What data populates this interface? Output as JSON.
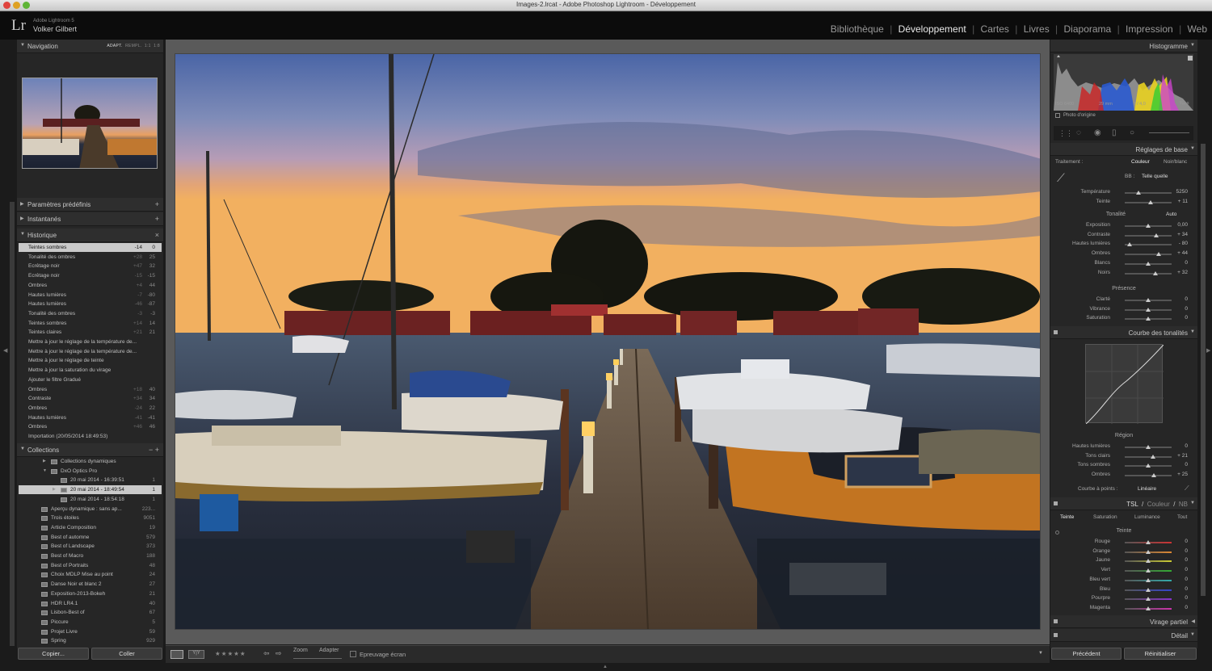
{
  "window": {
    "title": "Images-2.lrcat - Adobe Photoshop Lightroom - Développement"
  },
  "identity": {
    "logo": "Lr",
    "app": "Adobe Lightroom 5",
    "user": "Volker Gilbert"
  },
  "modules": [
    "Bibliothèque",
    "Développement",
    "Cartes",
    "Livres",
    "Diaporama",
    "Impression",
    "Web"
  ],
  "navigator": {
    "title": "Navigation",
    "options": [
      "ADAPT.",
      "REMPL.",
      "1:1",
      "1:8"
    ]
  },
  "presets": {
    "title": "Paramètres prédéfinis"
  },
  "snapshots": {
    "title": "Instantanés"
  },
  "history": {
    "title": "Historique",
    "items": [
      {
        "label": "Teintes sombres",
        "a": "-14",
        "b": "0"
      },
      {
        "label": "Tonalité des ombres",
        "a": "+28",
        "b": "25"
      },
      {
        "label": "Ecrêtage noir",
        "a": "+47",
        "b": "32"
      },
      {
        "label": "Ecrêtage noir",
        "a": "-15",
        "b": "-15"
      },
      {
        "label": "Ombres",
        "a": "+4",
        "b": "44"
      },
      {
        "label": "Hautes lumières",
        "a": "-7",
        "b": "-80"
      },
      {
        "label": "Hautes lumières",
        "a": "-46",
        "b": "-87"
      },
      {
        "label": "Tonalité des ombres",
        "a": "-3",
        "b": "-3"
      },
      {
        "label": "Teintes sombres",
        "a": "+14",
        "b": "14"
      },
      {
        "label": "Teintes claires",
        "a": "+21",
        "b": "21"
      },
      {
        "label": "Mettre à jour le réglage de la température de...",
        "a": "",
        "b": ""
      },
      {
        "label": "Mettre à jour le réglage de la température de...",
        "a": "",
        "b": ""
      },
      {
        "label": "Mettre à jour le réglage de teinte",
        "a": "",
        "b": ""
      },
      {
        "label": "Mettre à jour la saturation du virage",
        "a": "",
        "b": ""
      },
      {
        "label": "Ajouter le filtre Gradué",
        "a": "",
        "b": ""
      },
      {
        "label": "Ombres",
        "a": "+18",
        "b": "40"
      },
      {
        "label": "Contraste",
        "a": "+34",
        "b": "34"
      },
      {
        "label": "Ombres",
        "a": "-24",
        "b": "22"
      },
      {
        "label": "Hautes lumières",
        "a": "-41",
        "b": "-41"
      },
      {
        "label": "Ombres",
        "a": "+46",
        "b": "46"
      },
      {
        "label": "Importation (20/05/2014 18:49:53)",
        "a": "",
        "b": ""
      }
    ]
  },
  "collections": {
    "title": "Collections",
    "items": [
      {
        "label": "Collections dynamiques",
        "count": "",
        "lvl": 1,
        "tri": "▶"
      },
      {
        "label": "DxO Optics Pro",
        "count": "",
        "lvl": 1,
        "tri": "▼"
      },
      {
        "label": "20 mai 2014 - 16:39:51",
        "count": "1",
        "lvl": 2,
        "tri": ""
      },
      {
        "label": "20 mai 2014 - 18:49:54",
        "count": "1",
        "lvl": 2,
        "tri": "▶"
      },
      {
        "label": "20 mai 2014 - 18:54:18",
        "count": "1",
        "lvl": 2,
        "tri": ""
      },
      {
        "label": "Aperçu dynamique : sans ap...",
        "count": "223...",
        "lvl": 0,
        "tri": ""
      },
      {
        "label": "Trois étoiles",
        "count": "9051",
        "lvl": 0,
        "tri": ""
      },
      {
        "label": "Article Composition",
        "count": "19",
        "lvl": 0,
        "tri": ""
      },
      {
        "label": "Best of automne",
        "count": "579",
        "lvl": 0,
        "tri": ""
      },
      {
        "label": "Best of Landscape",
        "count": "373",
        "lvl": 0,
        "tri": ""
      },
      {
        "label": "Best of Macro",
        "count": "188",
        "lvl": 0,
        "tri": ""
      },
      {
        "label": "Best of Portraits",
        "count": "48",
        "lvl": 0,
        "tri": ""
      },
      {
        "label": "Choix MDLP Mise au point",
        "count": "24",
        "lvl": 0,
        "tri": ""
      },
      {
        "label": "Danse Noir et blanc 2",
        "count": "27",
        "lvl": 0,
        "tri": ""
      },
      {
        "label": "Exposition-2013-Bokeh",
        "count": "21",
        "lvl": 0,
        "tri": ""
      },
      {
        "label": "HDR LR4.1",
        "count": "40",
        "lvl": 0,
        "tri": ""
      },
      {
        "label": "Lisbon-Best of",
        "count": "67",
        "lvl": 0,
        "tri": ""
      },
      {
        "label": "Piccure",
        "count": "5",
        "lvl": 0,
        "tri": ""
      },
      {
        "label": "Projet Livre",
        "count": "59",
        "lvl": 0,
        "tri": ""
      },
      {
        "label": "Spring",
        "count": "929",
        "lvl": 0,
        "tri": ""
      }
    ]
  },
  "left_buttons": {
    "copy": "Copier...",
    "paste": "Coller"
  },
  "toolbar": {
    "zoom": "Zoom",
    "fit": "Adapter",
    "softproof": "Epreuvage écran",
    "stars": "★★★★★"
  },
  "histogram": {
    "title": "Histogramme",
    "iso": "ISO 6400",
    "focal": "29 mm",
    "aperture": "f / 4,0",
    "shutter": "¹⁄₆₄ s",
    "original": "Photo d'origine"
  },
  "basic": {
    "title": "Réglages de base",
    "treatment": "Traitement :",
    "color": "Couleur",
    "bw": "Noir/blanc",
    "wb_label": "BB :",
    "wb_value": "Telle quelle",
    "tone": "Tonalité",
    "auto": "Auto",
    "presence": "Présence",
    "sliders_wb": [
      {
        "label": "Température",
        "value": "5250",
        "pos": 0.3
      },
      {
        "label": "Teinte",
        "value": "+ 11",
        "pos": 0.55
      }
    ],
    "sliders_tone": [
      {
        "label": "Exposition",
        "value": "0,00",
        "pos": 0.5
      },
      {
        "label": "Contraste",
        "value": "+ 34",
        "pos": 0.67
      },
      {
        "label": "Hautes lumières",
        "value": "- 80",
        "pos": 0.1
      },
      {
        "label": "Ombres",
        "value": "+ 44",
        "pos": 0.72
      },
      {
        "label": "Blancs",
        "value": "0",
        "pos": 0.5
      },
      {
        "label": "Noirs",
        "value": "+ 32",
        "pos": 0.66
      }
    ],
    "sliders_presence": [
      {
        "label": "Clarté",
        "value": "0",
        "pos": 0.5
      },
      {
        "label": "Vibrance",
        "value": "0",
        "pos": 0.5
      },
      {
        "label": "Saturation",
        "value": "0",
        "pos": 0.5
      }
    ]
  },
  "curve": {
    "title": "Courbe des tonalités",
    "region": "Région",
    "sliders": [
      {
        "label": "Hautes lumières",
        "value": "0",
        "pos": 0.5
      },
      {
        "label": "Tons clairs",
        "value": "+ 21",
        "pos": 0.6
      },
      {
        "label": "Tons sombres",
        "value": "0",
        "pos": 0.5
      },
      {
        "label": "Ombres",
        "value": "+ 25",
        "pos": 0.62
      }
    ],
    "point_curve_label": "Courbe à points :",
    "point_curve_value": "Linéaire"
  },
  "hsl": {
    "title_parts": [
      "TSL",
      "Couleur",
      "NB"
    ],
    "tabs": [
      "Teinte",
      "Saturation",
      "Luminance",
      "Tout"
    ],
    "section": "Teinte",
    "sliders": [
      {
        "label": "Rouge",
        "value": "0",
        "color": "#c33"
      },
      {
        "label": "Orange",
        "value": "0",
        "color": "#d83"
      },
      {
        "label": "Jaune",
        "value": "0",
        "color": "#cc3"
      },
      {
        "label": "Vert",
        "value": "0",
        "color": "#3a3"
      },
      {
        "label": "Bleu vert",
        "value": "0",
        "color": "#3aa"
      },
      {
        "label": "Bleu",
        "value": "0",
        "color": "#34c"
      },
      {
        "label": "Pourpre",
        "value": "0",
        "color": "#83c"
      },
      {
        "label": "Magenta",
        "value": "0",
        "color": "#c3a"
      }
    ]
  },
  "split_toning": {
    "title": "Virage partiel"
  },
  "detail": {
    "title": "Détail"
  },
  "right_buttons": {
    "previous": "Précédent",
    "reset": "Réinitialiser"
  }
}
